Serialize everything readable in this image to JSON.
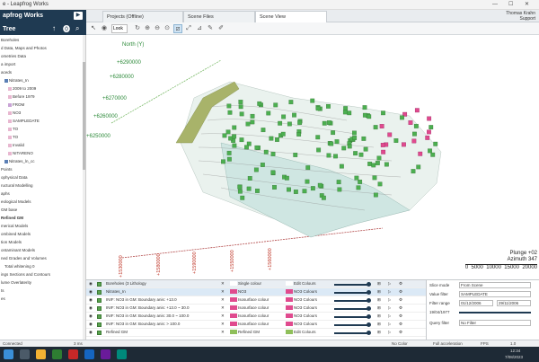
{
  "window": {
    "title": "Leapfrog Works",
    "title_prefix": "e - Leapfrog Works",
    "minimize": "—",
    "maximize": "☐",
    "close": "✕"
  },
  "app": {
    "name": "apfrog Works",
    "play_icon": "▶",
    "tree_title": "Tree"
  },
  "tabs": [
    {
      "label": "Projects (Offline)"
    },
    {
      "label": "Scene Files"
    },
    {
      "label": "Scene View"
    }
  ],
  "user": {
    "name": "Thomas Krahn",
    "sub": "Support"
  },
  "toolbar": {
    "view_select": "Look"
  },
  "tree": [
    {
      "label": "Boreholes",
      "indent": 0,
      "color": "",
      "bold": false
    },
    {
      "label": "d Data, Maps and Photos",
      "indent": 0,
      "color": "",
      "bold": false
    },
    {
      "label": "ometries Data",
      "indent": 0,
      "color": "",
      "bold": false
    },
    {
      "label": "a import",
      "indent": 0,
      "color": "",
      "bold": false
    },
    {
      "label": "aceds",
      "indent": 0,
      "color": "",
      "bold": false
    },
    {
      "label": "Nitrates_In",
      "indent": 1,
      "color": "#5b7fb5",
      "bold": false
    },
    {
      "label": "2009 to 2009",
      "indent": 2,
      "color": "#e8b7d0",
      "bold": false
    },
    {
      "label": "Before 1979",
      "indent": 2,
      "color": "#e8b7d0",
      "bold": false
    },
    {
      "label": "FROM",
      "indent": 2,
      "color": "#c9a3d6",
      "bold": false
    },
    {
      "label": "NO3",
      "indent": 2,
      "color": "#e8b7d0",
      "bold": false
    },
    {
      "label": "SAMPLEDATE",
      "indent": 2,
      "color": "#e8b7d0",
      "bold": false
    },
    {
      "label": "TO",
      "indent": 2,
      "color": "#e8b7d0",
      "bold": false
    },
    {
      "label": "TO",
      "indent": 2,
      "color": "#e8b7d0",
      "bold": false
    },
    {
      "label": "Invalid",
      "indent": 2,
      "color": "#e8b7d0",
      "bold": false
    },
    {
      "label": "NITARENO",
      "indent": 2,
      "color": "#e8b7d0",
      "bold": false
    },
    {
      "label": "Nitrates_ln_cc",
      "indent": 1,
      "color": "#5b7fb5",
      "bold": false
    },
    {
      "label": "Points",
      "indent": 0,
      "color": "",
      "bold": false
    },
    {
      "label": "ophysical Data",
      "indent": 0,
      "color": "",
      "bold": false
    },
    {
      "label": "ructural Modelling",
      "indent": 0,
      "color": "",
      "bold": false
    },
    {
      "label": "aphs",
      "indent": 0,
      "color": "",
      "bold": false
    },
    {
      "label": "eological Models",
      "indent": 0,
      "color": "",
      "bold": false
    },
    {
      "label": "GM base",
      "indent": 0,
      "color": "",
      "bold": false
    },
    {
      "label": "Refined GM",
      "indent": 0,
      "color": "",
      "bold": true
    },
    {
      "label": "merical Models",
      "indent": 0,
      "color": "",
      "bold": false
    },
    {
      "label": "ombined Models",
      "indent": 0,
      "color": "",
      "bold": false
    },
    {
      "label": "tion Models",
      "indent": 0,
      "color": "",
      "bold": false
    },
    {
      "label": "ontaminant Models",
      "indent": 0,
      "color": "",
      "bold": false
    },
    {
      "label": "ned Grades and Volumes",
      "indent": 0,
      "color": "",
      "bold": false
    },
    {
      "label": "Total whitening 0",
      "indent": 1,
      "color": "",
      "bold": false
    },
    {
      "label": "ings Sections and Contours",
      "indent": 0,
      "color": "",
      "bold": false
    },
    {
      "label": "lume Overlaterity",
      "indent": 0,
      "color": "",
      "bold": false
    },
    {
      "label": "ts",
      "indent": 0,
      "color": "",
      "bold": false
    },
    {
      "label": "es",
      "indent": 0,
      "color": "",
      "bold": false
    }
  ],
  "scene": {
    "axis_north": "North (Y)",
    "north_ticks": [
      "+6290000",
      "+6280000",
      "+6270000",
      "+6260000",
      "+6250000"
    ],
    "east_ticks": [
      "+1530000",
      "+1580000",
      "+1590000",
      "+1550000",
      "+1560000"
    ],
    "plunge": "Plunge +02",
    "azimuth": "Azimuth 347",
    "scale": [
      "0",
      "5000",
      "10000",
      "15000",
      "20000"
    ]
  },
  "colors": {
    "accent": "#1f3a52",
    "green": "#4caf50",
    "magenta": "#e04a8e",
    "terrain": "#d9dcc7"
  },
  "shapes_list": {
    "rows": [
      {
        "name": "Boreholes (3 Lithology",
        "style": "Single colour",
        "colour": "Edit Colours",
        "kind": "hdr",
        "swatch": "#ffffff"
      },
      {
        "name": "Nitrates_In",
        "style": "NO3",
        "colour": "NO3 Colours",
        "kind": "sel",
        "swatch": "#e04a8e"
      },
      {
        "name": "INIF: NO3 in GM: Boundary anis: +13.0",
        "style": "Isosurface colour",
        "colour": "NO3 Colours",
        "kind": "row",
        "swatch": "#e04a8e"
      },
      {
        "name": "INIF: NO3 in GM: Boundary anis: +13.0 ~ 30.0",
        "style": "Isosurface colour",
        "colour": "NO3 Colours",
        "kind": "row",
        "swatch": "#e04a8e"
      },
      {
        "name": "INIF: NO3 in GM: Boundary anis: 30.0 ~ 100.0",
        "style": "Isosurface colour",
        "colour": "NO3 Colours",
        "kind": "row",
        "swatch": "#e04a8e"
      },
      {
        "name": "INIF: NO3 in GM: Boundary anis: > 100.0",
        "style": "Isosurface colour",
        "colour": "NO3 Colours",
        "kind": "row",
        "swatch": "#e04a8e"
      },
      {
        "name": "Refined GM",
        "style": "Refined GM",
        "colour": "Edit Colours",
        "kind": "row",
        "swatch": "#8fbf5a"
      }
    ]
  },
  "properties": {
    "slice_mode_label": "Slice mode",
    "slice_mode": "From Scene",
    "values_label": "Value filter",
    "values": "SAMPLEDATE",
    "filter_range_label": "Filter range",
    "range_from": "01/12/2006",
    "range_to": "29/11/2006",
    "date_from": "19/04/1977",
    "query_label": "Query filter",
    "query": "No Filter"
  },
  "status": {
    "left": "Connected",
    "code": "3 ms",
    "no_color": "No Color",
    "acceleration": "Full acceleration",
    "fps": "FPS",
    "zscale": "1.0"
  },
  "taskbar": {
    "time": "12:34",
    "date": "7/08/2023"
  }
}
